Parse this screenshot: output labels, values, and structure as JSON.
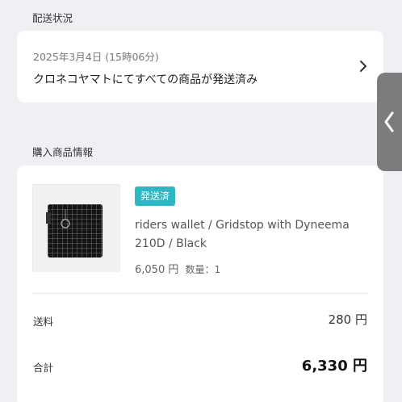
{
  "shipping_section": {
    "heading": "配送状況",
    "date": "2025年3月4日 (15時06分)",
    "status": "クロネコヤマトにてすべての商品が発送済み"
  },
  "items_section": {
    "heading": "購入商品情報",
    "item": {
      "badge": "発送済",
      "name": "riders wallet / Gridstop with Dyneema 210D / Black",
      "price": "6,050 円",
      "quantity": "数量：1"
    },
    "summary": {
      "shipping_label": "送料",
      "shipping_value": "280 円",
      "total_label": "合計",
      "total_value": "6,330 円"
    }
  },
  "colors": {
    "badge": "#2fb6c2",
    "background": "#eef0f4",
    "side_handle": "#7c7c7c"
  },
  "icons": {
    "chevron": "chevron-right-icon",
    "side_handle": "chevron-left-icon"
  }
}
